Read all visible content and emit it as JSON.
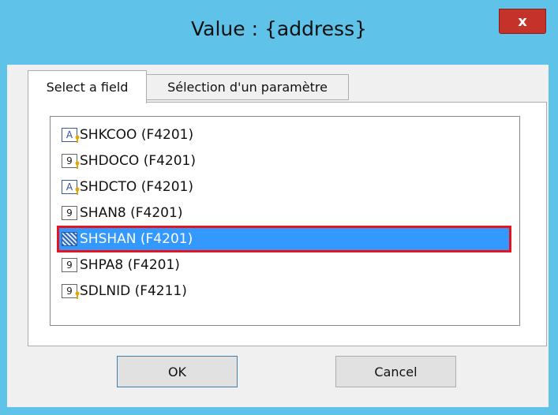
{
  "window": {
    "title": "Value : {address}",
    "close_label": "x"
  },
  "tabs": [
    {
      "label": "Select a field",
      "active": true
    },
    {
      "label": "Sélection d'un paramètre",
      "active": false
    }
  ],
  "fields": [
    {
      "label": "SHKCOO (F4201)",
      "icon": "text-key-field-icon",
      "icon_glyph": "A",
      "selected": false
    },
    {
      "label": "SHDOCO (F4201)",
      "icon": "numeric-key-field-icon",
      "icon_glyph": "9",
      "selected": false
    },
    {
      "label": "SHDCTO (F4201)",
      "icon": "text-key-field-icon",
      "icon_glyph": "A",
      "selected": false
    },
    {
      "label": "SHAN8 (F4201)",
      "icon": "numeric-field-icon",
      "icon_glyph": "9",
      "selected": false
    },
    {
      "label": "SHSHAN (F4201)",
      "icon": "pattern-field-icon",
      "icon_glyph": "",
      "selected": true
    },
    {
      "label": "SHPA8 (F4201)",
      "icon": "numeric-field-icon",
      "icon_glyph": "9",
      "selected": false
    },
    {
      "label": "SDLNID (F4211)",
      "icon": "numeric-key-field-icon",
      "icon_glyph": "9",
      "selected": false
    }
  ],
  "buttons": {
    "ok_label": "OK",
    "cancel_label": "Cancel"
  },
  "colors": {
    "title_bar": "#5fc2e8",
    "close_button": "#c4322a",
    "selection": "#3399ff",
    "selection_outline": "#e8141d"
  }
}
